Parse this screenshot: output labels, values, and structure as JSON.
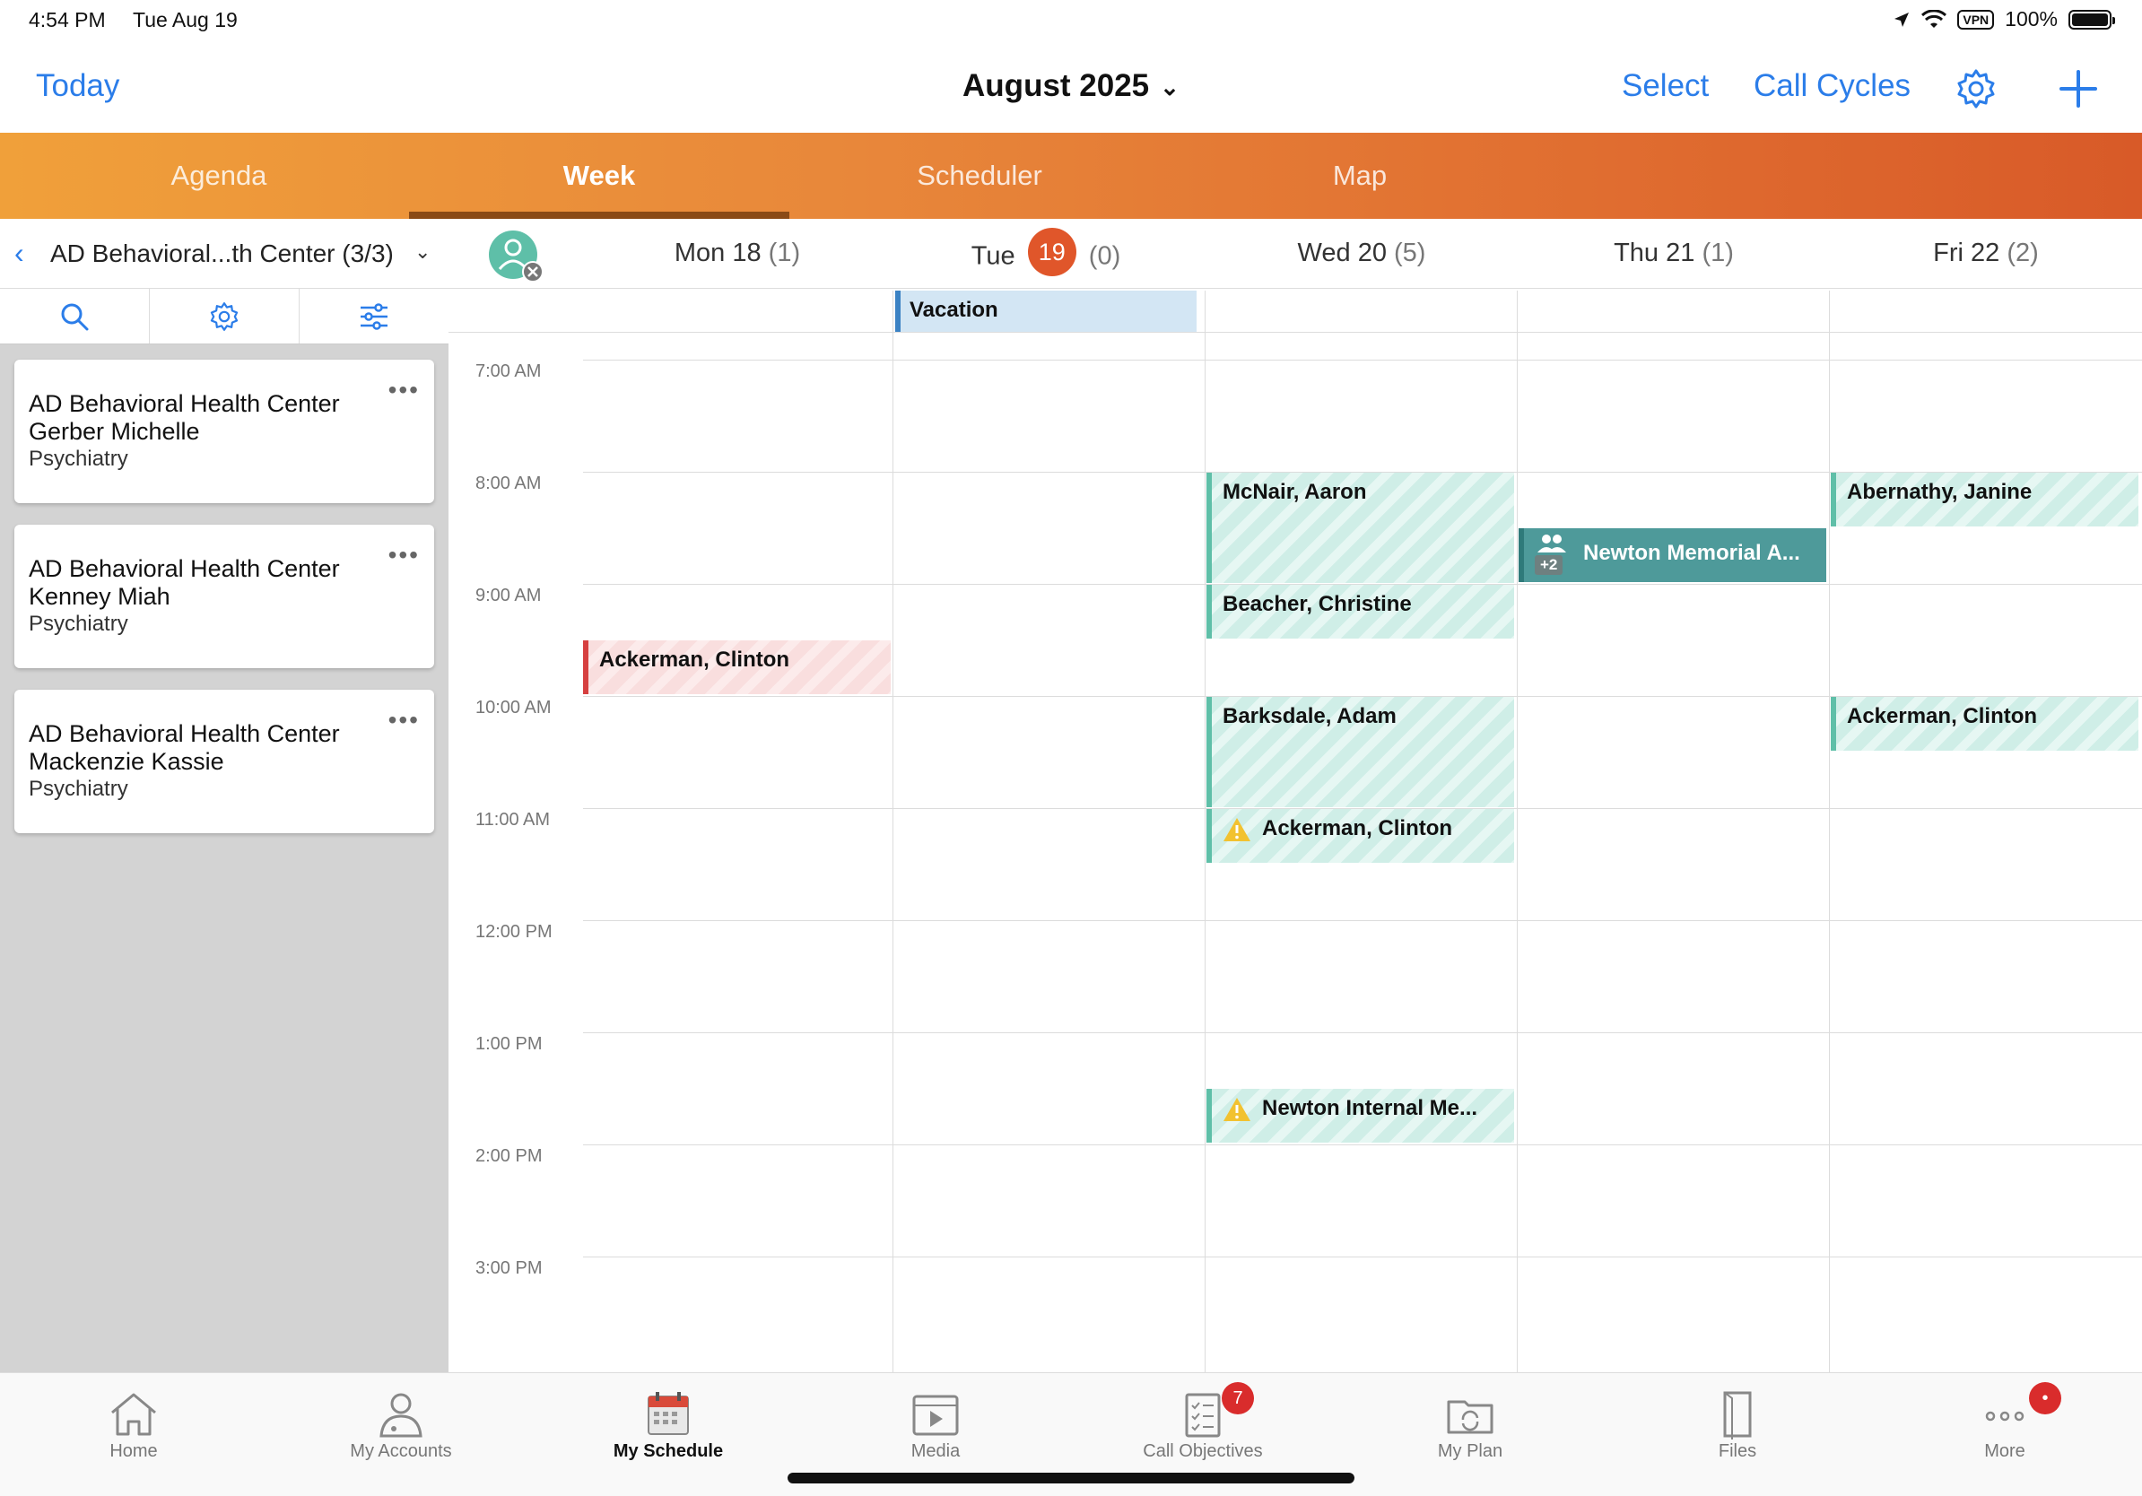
{
  "status_bar": {
    "time": "4:54 PM",
    "date": "Tue Aug 19",
    "vpn": "VPN",
    "battery": "100%"
  },
  "nav": {
    "today": "Today",
    "month": "August 2025",
    "select": "Select",
    "call_cycles": "Call Cycles"
  },
  "view_tabs": [
    {
      "label": "Agenda"
    },
    {
      "label": "Week"
    },
    {
      "label": "Scheduler"
    },
    {
      "label": "Map"
    }
  ],
  "left_panel": {
    "title": "AD Behavioral...th Center (3/3)",
    "cards": [
      {
        "line1": "AD Behavioral Health Center",
        "line2": "Gerber Michelle",
        "specialty": "Psychiatry",
        "more": "•••"
      },
      {
        "line1": "AD Behavioral Health Center",
        "line2": "Kenney Miah",
        "specialty": "Psychiatry",
        "more": "•••"
      },
      {
        "line1": "AD Behavioral Health Center",
        "line2": "Mackenzie Kassie",
        "specialty": "Psychiatry",
        "more": "•••"
      }
    ]
  },
  "days": [
    {
      "name": "Mon 18",
      "count": "(1)"
    },
    {
      "name": "Tue",
      "day_num": "19",
      "count": "(0)"
    },
    {
      "name": "Wed 20",
      "count": "(5)"
    },
    {
      "name": "Thu 21",
      "count": "(1)"
    },
    {
      "name": "Fri 22",
      "count": "(2)"
    }
  ],
  "all_day": {
    "vacation": "Vacation"
  },
  "times": [
    "7:00 AM",
    "8:00 AM",
    "9:00 AM",
    "10:00 AM",
    "11:00 AM",
    "12:00 PM",
    "1:00 PM",
    "2:00 PM",
    "3:00 PM"
  ],
  "events": {
    "mon_ackerman": "Ackerman, Clinton",
    "wed_mcnair": "McNair, Aaron",
    "wed_beacher": "Beacher, Christine",
    "wed_barksdale": "Barksdale, Adam",
    "wed_ackerman": "Ackerman, Clinton",
    "wed_newton": "Newton Internal Me...",
    "thu_newton": "Newton Memorial A...",
    "thu_newton_plus": "+2",
    "fri_abernathy": "Abernathy, Janine",
    "fri_ackerman": "Ackerman, Clinton"
  },
  "tab_bar": [
    {
      "label": "Home"
    },
    {
      "label": "My Accounts"
    },
    {
      "label": "My Schedule"
    },
    {
      "label": "Media"
    },
    {
      "label": "Call Objectives",
      "badge": "7"
    },
    {
      "label": "My Plan"
    },
    {
      "label": "Files"
    },
    {
      "label": "More"
    }
  ],
  "colors": {
    "accent": "#2b7de9",
    "today": "#e0562a",
    "visit": "#5fbfa8",
    "conflict": "#d64040",
    "meeting": "#4e9a9a"
  }
}
